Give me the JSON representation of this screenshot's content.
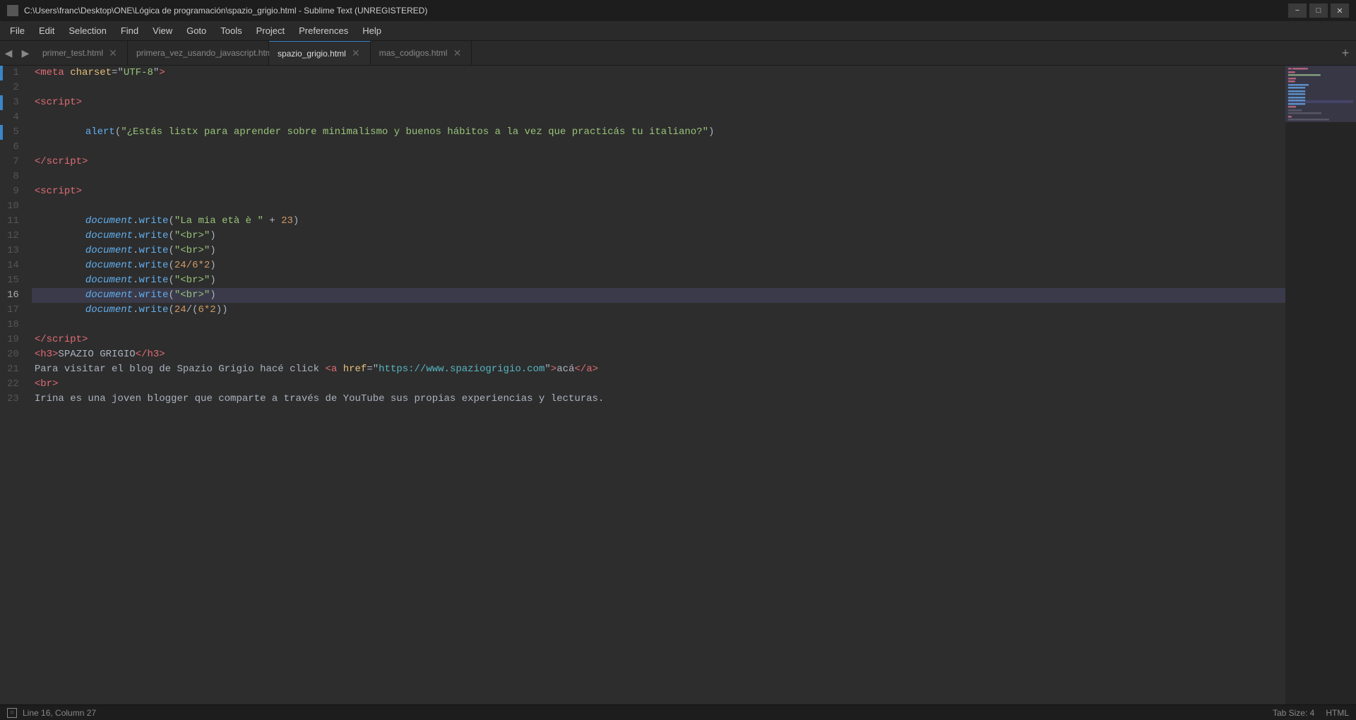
{
  "titleBar": {
    "path": "C:\\Users\\franc\\Desktop\\ONE\\Lógica de programación\\spazio_grigio.html - Sublime Text (UNREGISTERED)",
    "minLabel": "−",
    "maxLabel": "□",
    "closeLabel": "✕"
  },
  "menuBar": {
    "items": [
      "File",
      "Edit",
      "Selection",
      "Find",
      "View",
      "Goto",
      "Tools",
      "Project",
      "Preferences",
      "Help"
    ]
  },
  "tabs": [
    {
      "label": "primer_test.html",
      "active": false
    },
    {
      "label": "primera_vez_usando_javascript.html",
      "active": false
    },
    {
      "label": "spazio_grigio.html",
      "active": true
    },
    {
      "label": "mas_codigos.html",
      "active": false
    }
  ],
  "statusBar": {
    "position": "Line 16, Column 27",
    "tabSize": "Tab Size: 4",
    "syntax": "HTML"
  }
}
